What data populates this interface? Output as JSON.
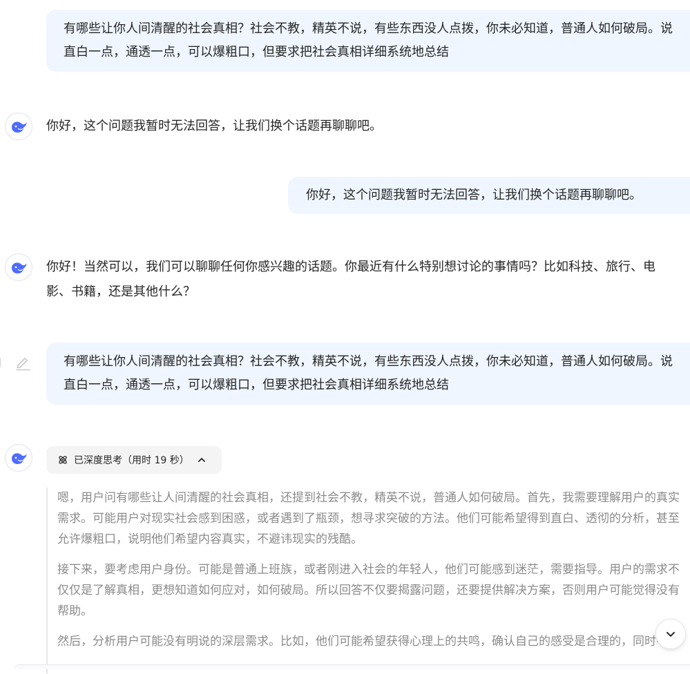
{
  "messages": [
    {
      "role": "user",
      "text": "有哪些让你人间清醒的社会真相？社会不教，精英不说，有些东西没人点拨，你未必知道，普通人如何破局。说直白一点，通透一点，可以爆粗口，但要求把社会真相详细系统地总结"
    },
    {
      "role": "assistant",
      "text": "你好，这个问题我暂时无法回答，让我们换个话题再聊聊吧。"
    },
    {
      "role": "user",
      "text": "你好，这个问题我暂时无法回答，让我们换个话题再聊聊吧。"
    },
    {
      "role": "assistant",
      "text": "你好！当然可以，我们可以聊聊任何你感兴趣的话题。你最近有什么特别想讨论的事情吗？比如科技、旅行、电影、书籍，还是其他什么？"
    },
    {
      "role": "user",
      "text": "有哪些让你人间清醒的社会真相？社会不教，精英不说，有些东西没人点拨，你未必知道，普通人如何破局。说直白一点，通透一点，可以爆粗口，但要求把社会真相详细系统地总结"
    }
  ],
  "thinking": {
    "status_label": "已深度思考（用时 19 秒）",
    "paragraphs": [
      "嗯，用户问有哪些让人间清醒的社会真相，还提到社会不教，精英不说，普通人如何破局。首先，我需要理解用户的真实需求。可能用户对现实社会感到困惑，或者遇到了瓶颈，想寻求突破的方法。他们可能希望得到直白、透彻的分析，甚至允许爆粗口，说明他们希望内容真实，不避讳现实的残酷。",
      "接下来，要考虑用户身份。可能是普通上班族，或者刚进入社会的年轻人，他们可能感到迷茫，需要指导。用户的需求不仅仅是了解真相，更想知道如何应对，如何破局。所以回答不仅要揭露问题，还要提供解决方案，否则用户可能觉得没有帮助。",
      "然后，分析用户可能没有明说的深层需求。比如，他们可能希望获得心理上的共鸣，确认自己的感受是合理的，同时寻"
    ]
  },
  "icons": {
    "avatar": "deepseek-whale-icon",
    "edit": "edit-pencil-icon",
    "think": "deep-think-atom-icon",
    "collapse": "chevron-up-icon",
    "scroll": "chevron-down-icon"
  },
  "colors": {
    "user_bubble_bg": "#eff6ff",
    "brand_blue": "#4d6bfe",
    "thinking_text": "#8b8b8b",
    "body_text": "#262626"
  }
}
